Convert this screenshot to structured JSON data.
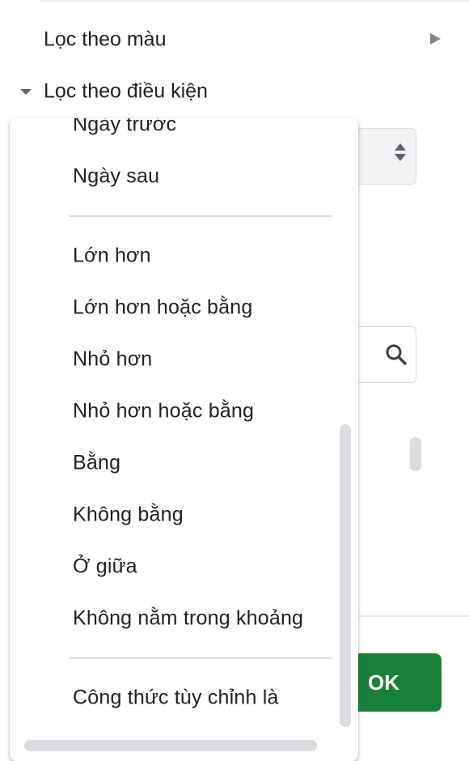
{
  "panel": {
    "filter_by_color": "Lọc theo màu",
    "filter_by_condition": "Lọc theo điều kiện",
    "ok_label": "OK"
  },
  "icons": {
    "submenu_arrow": "triangle-right-icon",
    "section_toggle": "triangle-down-icon",
    "select_arrows": "sort-up-down-icon",
    "search": "search-icon"
  },
  "menu": {
    "items": [
      "Ngày trước",
      "Ngày sau",
      "Lớn hơn",
      "Lớn hơn hoặc bằng",
      "Nhỏ hơn",
      "Nhỏ hơn hoặc bằng",
      "Bằng",
      "Không bằng",
      "Ở giữa",
      "Không nằm trong khoảng",
      "Công thức tùy chỉnh là"
    ]
  },
  "colors": {
    "ok_button": "#188038",
    "text": "#202124",
    "scrollbar": "#dadce0"
  }
}
